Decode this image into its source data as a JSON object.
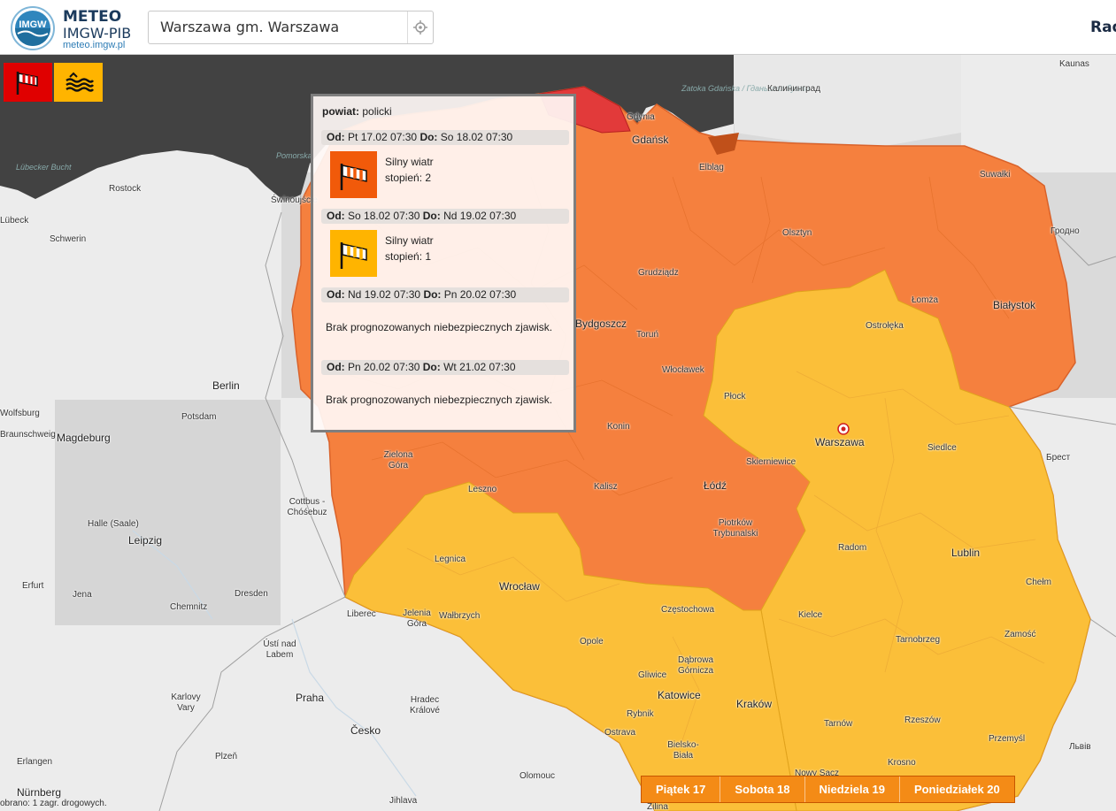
{
  "header": {
    "logo_title": "METEO",
    "logo_subtitle": "IMGW-PIB",
    "logo_url": "meteo.imgw.pl",
    "logo_mark_text": "IMGW",
    "search": {
      "value": "Warszawa gm. Warszawa",
      "placeholder": ""
    },
    "nav_partial": "Rad"
  },
  "legend": [
    {
      "icon": "wind-icon",
      "color": "#e00000"
    },
    {
      "icon": "high-water-icon",
      "color": "#ffb400"
    }
  ],
  "popup": {
    "region_label": "powiat:",
    "region_name": "policki",
    "periods": [
      {
        "from_label": "Od:",
        "from": "Pt 17.02 07:30",
        "to_label": "Do:",
        "to": "So 18.02 07:30",
        "warning": "Silny wiatr",
        "degree": "stopień: 2",
        "color": "#f15a0a"
      },
      {
        "from_label": "Od:",
        "from": "So 18.02 07:30",
        "to_label": "Do:",
        "to": "Nd 19.02 07:30",
        "warning": "Silny wiatr",
        "degree": "stopień: 1",
        "color": "#ffb400"
      },
      {
        "from_label": "Od:",
        "from": "Nd 19.02 07:30",
        "to_label": "Do:",
        "to": "Pn 20.02 07:30",
        "message": "Brak prognozowanych niebezpiecznych zjawisk."
      },
      {
        "from_label": "Od:",
        "from": "Pn 20.02 07:30",
        "to_label": "Do:",
        "to": "Wt 21.02 07:30",
        "message": "Brak prognozowanych niebezpiecznych zjawisk."
      }
    ]
  },
  "day_tabs": [
    "Piątek 17",
    "Sobota 18",
    "Niedziela 19",
    "Poniedziałek 20"
  ],
  "scale_note": "obrano: 1 zagr. drogowych.",
  "colors": {
    "level1": "#fbbf39",
    "level2": "#f5803e",
    "level3": "#e23a3a",
    "sea": "#404040",
    "land": "#ececec",
    "tab": "#f48b16"
  },
  "map_labels": {
    "seas": [
      "Zatoka Gdańska / Гданьская бухта",
      "Lübecker Bucht",
      "Pomorska"
    ],
    "cities_pl": [
      "Gdynia",
      "Gdańsk",
      "Elbląg",
      "Suwałki",
      "Olsztyn",
      "Grudziądz",
      "Bydgoszcz",
      "Toruń",
      "Łomża",
      "Białystok",
      "Ostrołęka",
      "Włocławek",
      "Płock",
      "Warszawa",
      "Siedlce",
      "Konin",
      "Zielona Góra",
      "Kalisz",
      "Leszno",
      "Skierniewice",
      "Łódź",
      "Piotrków Trybunalski",
      "Radom",
      "Lublin",
      "Chełm",
      "Legnica",
      "Wrocław",
      "Jelenia Góra",
      "Wałbrzych",
      "Opole",
      "Częstochowa",
      "Kielce",
      "Zamość",
      "Tarnobrzeg",
      "Dąbrowa Górnicza",
      "Gliwice",
      "Katowice",
      "Rybnik",
      "Kraków",
      "Tarnów",
      "Rzeszów",
      "Przemyśl",
      "Bielsko-Biała",
      "Nowy Sącz",
      "Krosno",
      "Świnoujście"
    ],
    "cities_foreign": [
      "Kaunas",
      "Калининград",
      "Гродно",
      "Брест",
      "Львів",
      "Rostock",
      "Lübeck",
      "Schwerin",
      "Wolfsburg",
      "Braunschweig",
      "Magdeburg",
      "Berlin",
      "Potsdam",
      "Halle (Saale)",
      "Leipzig",
      "Erfurt",
      "Jena",
      "Chemnitz",
      "Dresden",
      "Cottbus - Chóśebuz",
      "Liberec",
      "Ústí nad Labem",
      "Karlovy Vary",
      "Praha",
      "Hradec Králové",
      "Česko",
      "Plzeň",
      "Erlangen",
      "Nürnberg",
      "Jihlava",
      "Olomouc",
      "Ostrava",
      "Žilina"
    ]
  }
}
